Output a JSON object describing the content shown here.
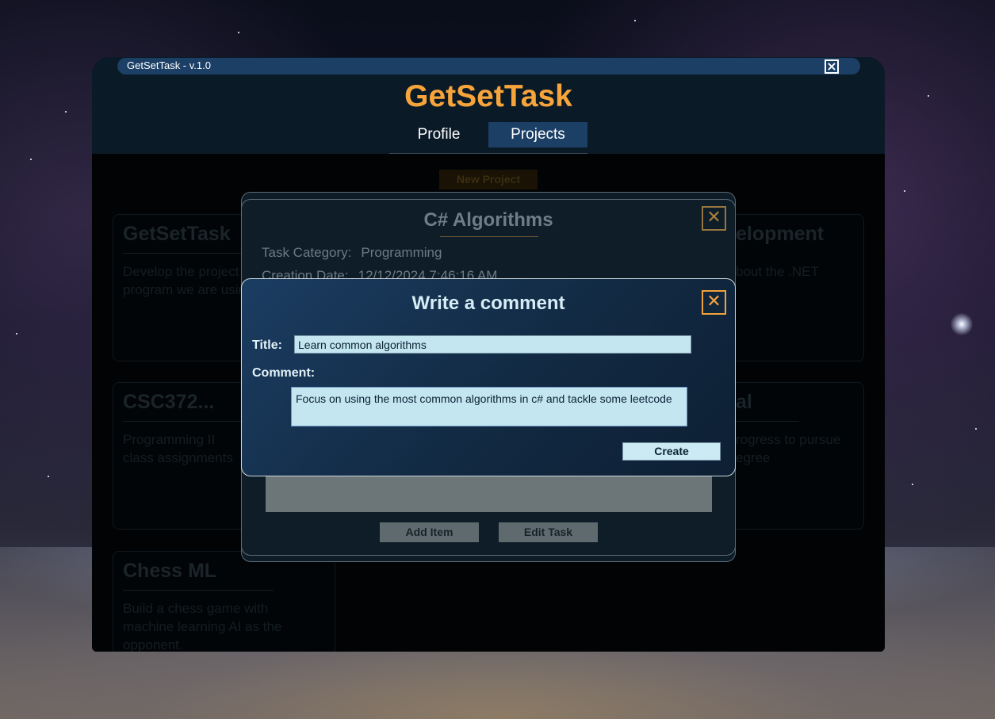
{
  "app": {
    "window_title": "GetSetTask - v.1.0",
    "brand": "GetSetTask",
    "nav": [
      {
        "label": "Profile",
        "active": false
      },
      {
        "label": "Projects",
        "active": true
      }
    ],
    "new_project_label": "New Project"
  },
  "projects": [
    {
      "title": "GetSetTask",
      "description": "Develop the project management program we are using."
    },
    {
      "title": "elopment",
      "description": "bout the .NET"
    },
    {
      "title": "CSC372...",
      "description": "Programming II class assignments"
    },
    {
      "title": "al",
      "description": "rogress to pursue egree"
    },
    {
      "title": "Chess ML",
      "description": "Build a chess game with machine learning AI as the opponent."
    }
  ],
  "task_dialog": {
    "title": "C# Algorithms",
    "category_label": "Task Category:",
    "category_value": "Programming",
    "creation_label": "Creation Date:",
    "creation_value": "12/12/2024 7:46:16 AM",
    "add_item_label": "Add Item",
    "edit_task_label": "Edit Task",
    "close_icon": "close-icon"
  },
  "comment_dialog": {
    "title": "Write a comment",
    "title_label": "Title:",
    "title_value": "Learn common algorithms",
    "comment_label": "Comment:",
    "comment_value": "Focus on using the most common algorithms in c# and tackle some leetcode",
    "create_label": "Create",
    "close_icon": "close-icon"
  },
  "colors": {
    "brand": "#f7a43b",
    "accent": "#1c3f66",
    "input_bg": "#c3e6f1"
  }
}
